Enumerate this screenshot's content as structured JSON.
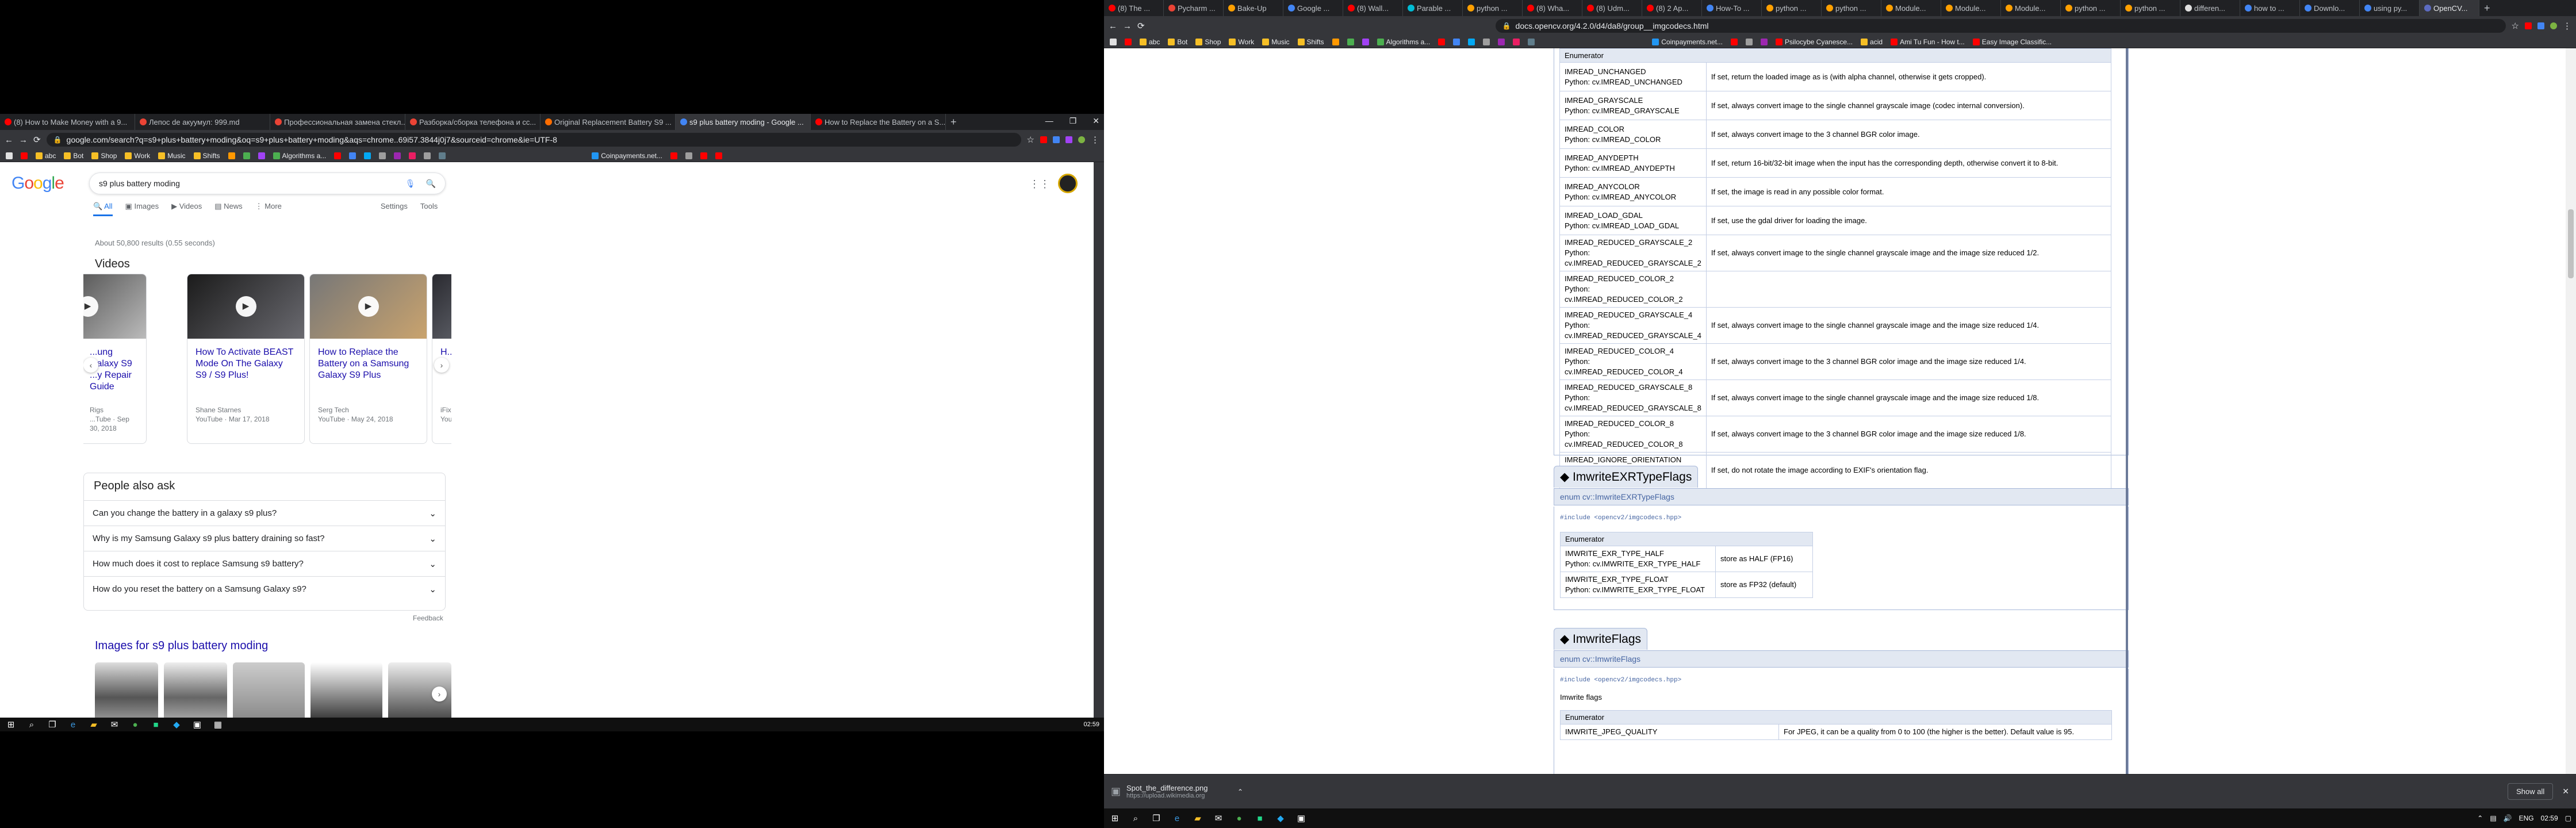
{
  "left_browser": {
    "tabs": [
      {
        "label": "(8) How to Make Money with a 9...",
        "color": "#ff0000"
      },
      {
        "label": "Лепос de акуумул: 999.md",
        "color": "#ea4335"
      },
      {
        "label": "Профессиональная замена стекл...",
        "color": "#ea4335"
      },
      {
        "label": "Разборка/сборка телефона и сс...",
        "color": "#ea4335"
      },
      {
        "label": "Original Replacement Battery S9 ...",
        "color": "#ff6d00"
      },
      {
        "label": "s9 plus battery moding - Google ...",
        "color": "#4285f4"
      },
      {
        "label": "How to Replace the Battery on a S...",
        "color": "#ff0000"
      }
    ],
    "url": "google.com/search?q=s9+plus+battery+moding&oq=s9+plus+battery+moding&aqs=chrome..69i57.3844j0j7&sourceid=chrome&ie=UTF-8",
    "bookmarks": [
      "abc",
      "Bot",
      "Shop",
      "Work",
      "Music",
      "Shifts",
      "Algorithms a...",
      "Coinpayments.net..."
    ]
  },
  "google": {
    "query": "s9 plus battery moding",
    "tabs": [
      "All",
      "Images",
      "Videos",
      "News",
      "More"
    ],
    "tools": [
      "Settings",
      "Tools"
    ],
    "stats": "About 50,800 results (0.55 seconds)",
    "videos_heading": "Videos",
    "videos": [
      {
        "title": "...ung Galaxy S9 ...y Repair Guide",
        "source": "Rigs",
        "site": "...Tube · Sep 30, 2018"
      },
      {
        "title": "How To Activate BEAST Mode On The Galaxy S9 / S9 Plus!",
        "source": "Shane Starnes",
        "site": "YouTube · Mar 17, 2018"
      },
      {
        "title": "How to Replace the Battery on a Samsung Galaxy S9 Plus",
        "source": "Serg Tech",
        "site": "YouTube · May 24, 2018"
      },
      {
        "title": "H... ...",
        "source": "iFix...",
        "site": "You..."
      }
    ],
    "paa_heading": "People also ask",
    "paa": [
      "Can you change the battery in a galaxy s9 plus?",
      "Why is my Samsung Galaxy s9 plus battery draining so fast?",
      "How much does it cost to replace Samsung s9 battery?",
      "How do you reset the battery on a Samsung Galaxy s9?"
    ],
    "feedback": "Feedback",
    "images_heading": "Images for s9 plus battery moding"
  },
  "left_taskbar": {
    "clock": "02:59"
  },
  "right_browser": {
    "tabs": [
      "(8) The ...",
      "Pycharm ...",
      "Bake-Up",
      "Google ...",
      "(8) Wall...",
      "Parable ...",
      "python ...",
      "(8) Wha...",
      "(8) Udm...",
      "(8) 2 Ap...",
      "How-To ...",
      "python ...",
      "python ...",
      "Module...",
      "Module...",
      "Module...",
      "python ...",
      "python ...",
      "differen...",
      "how to ...",
      "Downlo...",
      "using py...",
      "OpenCV..."
    ],
    "url": "docs.opencv.org/4.2.0/d4/da8/group__imgcodecs.html",
    "bookmarks": [
      "abc",
      "Bot",
      "Shop",
      "Work",
      "Music",
      "Shifts",
      "Algorithms a...",
      "Coinpayments.net...",
      "Psilocybe Cyanesce...",
      "acid",
      "Ami Tu Fun - How t...",
      "Easy Image Classific..."
    ]
  },
  "opencv": {
    "enum_header": "Enumerator",
    "imread_rows": [
      {
        "name": "IMREAD_UNCHANGED",
        "py": "Python: cv.IMREAD_UNCHANGED",
        "desc": "If set, return the loaded image as is (with alpha channel, otherwise it gets cropped)."
      },
      {
        "name": "IMREAD_GRAYSCALE",
        "py": "Python: cv.IMREAD_GRAYSCALE",
        "desc": "If set, always convert image to the single channel grayscale image (codec internal conversion)."
      },
      {
        "name": "IMREAD_COLOR",
        "py": "Python: cv.IMREAD_COLOR",
        "desc": "If set, always convert image to the 3 channel BGR color image."
      },
      {
        "name": "IMREAD_ANYDEPTH",
        "py": "Python: cv.IMREAD_ANYDEPTH",
        "desc": "If set, return 16-bit/32-bit image when the input has the corresponding depth, otherwise convert it to 8-bit."
      },
      {
        "name": "IMREAD_ANYCOLOR",
        "py": "Python: cv.IMREAD_ANYCOLOR",
        "desc": "If set, the image is read in any possible color format."
      },
      {
        "name": "IMREAD_LOAD_GDAL",
        "py": "Python: cv.IMREAD_LOAD_GDAL",
        "desc": "If set, use the gdal driver for loading the image."
      },
      {
        "name": "IMREAD_REDUCED_GRAYSCALE_2",
        "py": "Python: cv.IMREAD_REDUCED_GRAYSCALE_2",
        "desc": "If set, always convert image to the single channel grayscale image and the image size reduced 1/2."
      },
      {
        "name": "IMREAD_REDUCED_COLOR_2",
        "py": "Python: cv.IMREAD_REDUCED_COLOR_2",
        "desc": ""
      },
      {
        "name": "IMREAD_REDUCED_GRAYSCALE_4",
        "py": "Python: cv.IMREAD_REDUCED_GRAYSCALE_4",
        "desc": "If set, always convert image to the single channel grayscale image and the image size reduced 1/4."
      },
      {
        "name": "IMREAD_REDUCED_COLOR_4",
        "py": "Python: cv.IMREAD_REDUCED_COLOR_4",
        "desc": "If set, always convert image to the 3 channel BGR color image and the image size reduced 1/4."
      },
      {
        "name": "IMREAD_REDUCED_GRAYSCALE_8",
        "py": "Python: cv.IMREAD_REDUCED_GRAYSCALE_8",
        "desc": "If set, always convert image to the single channel grayscale image and the image size reduced 1/8."
      },
      {
        "name": "IMREAD_REDUCED_COLOR_8",
        "py": "Python: cv.IMREAD_REDUCED_COLOR_8",
        "desc": "If set, always convert image to the 3 channel BGR color image and the image size reduced 1/8."
      },
      {
        "name": "IMREAD_IGNORE_ORIENTATION",
        "py": "Python: cv.IMREAD_IGNORE_ORIENTATION",
        "desc": "If set, do not rotate the image according to EXIF's orientation flag."
      }
    ],
    "exr_title": "◆ ImwriteEXRTypeFlags",
    "exr_enum": "enum cv::ImwriteEXRTypeFlags",
    "include": "#include <opencv2/imgcodecs.hpp>",
    "exr_rows": [
      {
        "name": "IMWRITE_EXR_TYPE_HALF",
        "py": "Python: cv.IMWRITE_EXR_TYPE_HALF",
        "desc": "store as HALF (FP16)"
      },
      {
        "name": "IMWRITE_EXR_TYPE_FLOAT",
        "py": "Python: cv.IMWRITE_EXR_TYPE_FLOAT",
        "desc": "store as FP32 (default)"
      }
    ],
    "imwrite_title": "◆ ImwriteFlags",
    "imwrite_enum": "enum cv::ImwriteFlags",
    "imwrite_desc": "Imwrite flags",
    "last_row": {
      "name": "IMWRITE_JPEG_QUALITY",
      "desc": "For JPEG, it can be a quality from 0 to 100 (the higher is the better). Default value is 95."
    }
  },
  "download": {
    "file": "Spot_the_difference.png",
    "url": "https://upload.wikimedia.org",
    "show_all": "Show all"
  },
  "right_taskbar": {
    "lang": "ENG",
    "clock": "02:59"
  }
}
